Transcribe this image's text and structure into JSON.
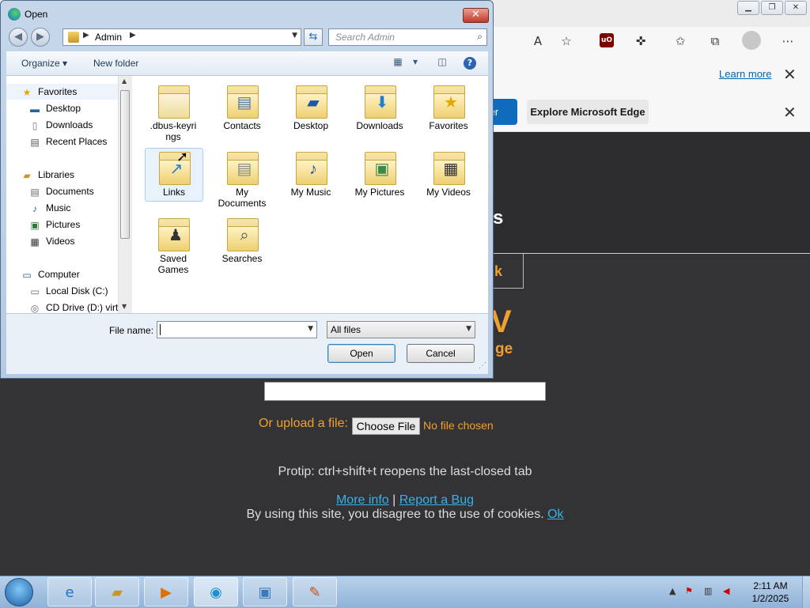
{
  "browser": {
    "learn_more": "Learn more",
    "blue_button_fragment": "ser",
    "explore_label": "Explore Microsoft Edge",
    "page": {
      "heading_fragment": "s",
      "button_fragment": "k",
      "big_fragment": "V",
      "sub_fragment": "ge",
      "upload_label": "Or upload a file:",
      "choose_file": "Choose File",
      "no_file": "No file chosen",
      "protip": "Protip: ctrl+shift+t reopens the last-closed tab",
      "more_info": "More info",
      "separator": "|",
      "report_bug": "Report a Bug",
      "cookies_text": "By using this site, you disagree to the use of cookies.",
      "ok": "Ok"
    }
  },
  "dialog": {
    "title": "Open",
    "address": "Admin",
    "search_placeholder": "Search Admin",
    "organize": "Organize",
    "new_folder": "New folder",
    "nav": [
      {
        "label": "Favorites",
        "icon": "favorites-star-icon"
      },
      {
        "label": "Desktop",
        "icon": "desktop-icon"
      },
      {
        "label": "Downloads",
        "icon": "downloads-icon"
      },
      {
        "label": "Recent Places",
        "icon": "recent-places-icon"
      },
      {
        "label": "Libraries",
        "icon": "libraries-icon"
      },
      {
        "label": "Documents",
        "icon": "documents-icon"
      },
      {
        "label": "Music",
        "icon": "music-icon"
      },
      {
        "label": "Pictures",
        "icon": "pictures-icon"
      },
      {
        "label": "Videos",
        "icon": "videos-icon"
      },
      {
        "label": "Computer",
        "icon": "computer-icon"
      },
      {
        "label": "Local Disk (C:)",
        "icon": "local-disk-icon"
      },
      {
        "label": "CD Drive (D:) virt",
        "icon": "cd-drive-icon"
      }
    ],
    "folders": [
      {
        "line1": ".dbus-keyri",
        "line2": "ngs"
      },
      {
        "line1": "Contacts",
        "line2": ""
      },
      {
        "line1": "Desktop",
        "line2": ""
      },
      {
        "line1": "Downloads",
        "line2": ""
      },
      {
        "line1": "Favorites",
        "line2": ""
      },
      {
        "line1": "Links",
        "line2": ""
      },
      {
        "line1": "My",
        "line2": "Documents"
      },
      {
        "line1": "My Music",
        "line2": ""
      },
      {
        "line1": "My Pictures",
        "line2": ""
      },
      {
        "line1": "My Videos",
        "line2": ""
      },
      {
        "line1": "Saved",
        "line2": "Games"
      },
      {
        "line1": "Searches",
        "line2": ""
      }
    ],
    "file_name_label": "File name:",
    "file_name_value": "",
    "file_type": "All files",
    "open_button": "Open",
    "cancel_button": "Cancel"
  },
  "taskbar": {
    "time": "2:11 AM",
    "date": "1/2/2025"
  }
}
